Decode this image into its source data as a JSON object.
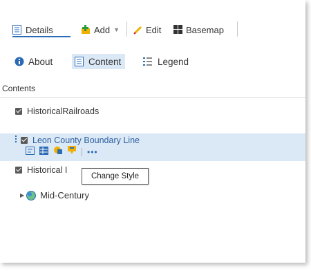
{
  "toolbar": {
    "details_label": "Details",
    "add_label": "Add",
    "edit_label": "Edit",
    "basemap_label": "Basemap"
  },
  "subtabs": {
    "about_label": "About",
    "content_label": "Content",
    "legend_label": "Legend"
  },
  "contents_heading": "Contents",
  "layers": [
    {
      "name": "HistoricalRailroads",
      "checked": true
    },
    {
      "name": "Leon County Boundary Line",
      "checked": true,
      "selected": true
    },
    {
      "name": "Historical I",
      "checked": true
    },
    {
      "name": "Mid-Century",
      "group": true
    }
  ],
  "tooltip": "Change Style",
  "colors": {
    "accent": "#2b6bb5",
    "selection": "#dbe8f6",
    "add_icon": "#f0b000",
    "edit_icon": "#f0b000"
  }
}
